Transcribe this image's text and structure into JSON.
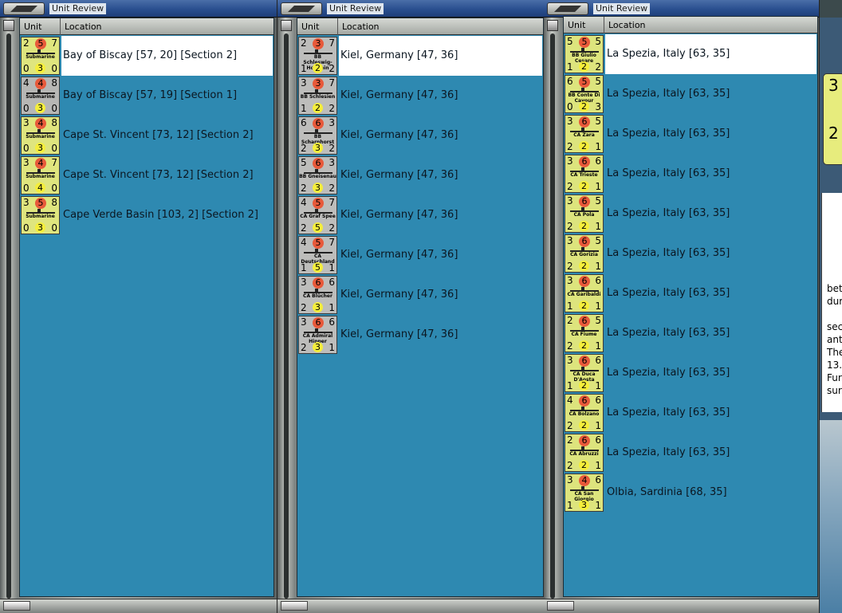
{
  "windows": [
    {
      "title": "Unit Review",
      "columns": {
        "unit": "Unit",
        "location": "Location"
      },
      "rows": [
        {
          "tl": "2",
          "att": "5",
          "tr": "7",
          "name": "Submarine",
          "bl": "0",
          "def": "3",
          "br": "0",
          "style": "sub",
          "location": "Bay of Biscay [57, 20] [Section 2]",
          "selected": true
        },
        {
          "tl": "4",
          "att": "4",
          "tr": "8",
          "name": "Submarine",
          "bl": "0",
          "def": "3",
          "br": "0",
          "style": "subg",
          "location": "Bay of Biscay [57, 19] [Section 1]"
        },
        {
          "tl": "3",
          "att": "4",
          "tr": "8",
          "name": "Submarine",
          "bl": "0",
          "def": "3",
          "br": "0",
          "style": "sub",
          "location": "Cape St. Vincent [73, 12] [Section 2]"
        },
        {
          "tl": "3",
          "att": "4",
          "tr": "7",
          "name": "Submarine",
          "bl": "0",
          "def": "4",
          "br": "0",
          "style": "sub",
          "location": "Cape St. Vincent [73, 12] [Section 2]"
        },
        {
          "tl": "3",
          "att": "5",
          "tr": "8",
          "name": "Submarine",
          "bl": "0",
          "def": "3",
          "br": "0",
          "style": "sub",
          "location": "Cape Verde Basin [103, 2] [Section 2]"
        }
      ]
    },
    {
      "title": "Unit Review",
      "columns": {
        "unit": "Unit",
        "location": "Location"
      },
      "rows": [
        {
          "tl": "2",
          "att": "3",
          "tr": "7",
          "name": "BB Schleswig-Holstein",
          "bl": "1",
          "def": "2",
          "br": "2",
          "style": "ger",
          "location": "Kiel, Germany [47, 36]",
          "selected": true
        },
        {
          "tl": "3",
          "att": "3",
          "tr": "7",
          "name": "BB Schlesien",
          "bl": "1",
          "def": "2",
          "br": "2",
          "style": "ger",
          "location": "Kiel, Germany [47, 36]"
        },
        {
          "tl": "6",
          "att": "6",
          "tr": "3",
          "name": "BB Scharnhorst",
          "bl": "2",
          "def": "3",
          "br": "2",
          "style": "ger",
          "location": "Kiel, Germany [47, 36]"
        },
        {
          "tl": "5",
          "att": "6",
          "tr": "3",
          "name": "BB Gneisenau",
          "bl": "2",
          "def": "3",
          "br": "2",
          "style": "ger",
          "location": "Kiel, Germany [47, 36]"
        },
        {
          "tl": "4",
          "att": "5",
          "tr": "7",
          "name": "CA Graf Spee",
          "bl": "2",
          "def": "5",
          "br": "2",
          "style": "ger",
          "location": "Kiel, Germany [47, 36]"
        },
        {
          "tl": "4",
          "att": "5",
          "tr": "7",
          "name": "CA Deutschland",
          "bl": "1",
          "def": "5",
          "br": "1",
          "style": "ger",
          "location": "Kiel, Germany [47, 36]"
        },
        {
          "tl": "3",
          "att": "6",
          "tr": "6",
          "name": "CA Blücher",
          "bl": "2",
          "def": "3",
          "br": "1",
          "style": "ger",
          "location": "Kiel, Germany [47, 36]"
        },
        {
          "tl": "3",
          "att": "6",
          "tr": "6",
          "name": "CA Admiral Hipper",
          "bl": "2",
          "def": "3",
          "br": "1",
          "style": "ger",
          "location": "Kiel, Germany [47, 36]"
        }
      ]
    },
    {
      "title": "Unit Review",
      "columns": {
        "unit": "Unit",
        "location": "Location"
      },
      "rows": [
        {
          "tl": "5",
          "att": "5",
          "tr": "5",
          "name": "BB Giulio Cesare",
          "bl": "1",
          "def": "2",
          "br": "2",
          "style": "ita",
          "location": "La Spezia, Italy [63, 35]",
          "selected": true
        },
        {
          "tl": "6",
          "att": "5",
          "tr": "5",
          "name": "BB Conte Di Cavour",
          "bl": "0",
          "def": "2",
          "br": "3",
          "style": "ita",
          "location": "La Spezia, Italy [63, 35]"
        },
        {
          "tl": "3",
          "att": "6",
          "tr": "5",
          "name": "CA Zara",
          "bl": "2",
          "def": "2",
          "br": "1",
          "style": "ita",
          "location": "La Spezia, Italy [63, 35]"
        },
        {
          "tl": "3",
          "att": "6",
          "tr": "6",
          "name": "CA Trieste",
          "bl": "2",
          "def": "2",
          "br": "1",
          "style": "ita",
          "location": "La Spezia, Italy [63, 35]"
        },
        {
          "tl": "3",
          "att": "6",
          "tr": "5",
          "name": "CA Pola",
          "bl": "2",
          "def": "2",
          "br": "1",
          "style": "ita",
          "location": "La Spezia, Italy [63, 35]"
        },
        {
          "tl": "3",
          "att": "6",
          "tr": "5",
          "name": "CA Gorizia",
          "bl": "2",
          "def": "2",
          "br": "1",
          "style": "ita",
          "location": "La Spezia, Italy [63, 35]"
        },
        {
          "tl": "3",
          "att": "6",
          "tr": "6",
          "name": "CA Garibaldi",
          "bl": "1",
          "def": "2",
          "br": "1",
          "style": "ita",
          "location": "La Spezia, Italy [63, 35]"
        },
        {
          "tl": "2",
          "att": "6",
          "tr": "5",
          "name": "CA Fiume",
          "bl": "2",
          "def": "2",
          "br": "1",
          "style": "ita",
          "location": "La Spezia, Italy [63, 35]"
        },
        {
          "tl": "3",
          "att": "6",
          "tr": "6",
          "name": "CA Duca D'Aosta",
          "bl": "1",
          "def": "2",
          "br": "1",
          "style": "ita",
          "location": "La Spezia, Italy [63, 35]"
        },
        {
          "tl": "4",
          "att": "6",
          "tr": "6",
          "name": "CA Bolzano",
          "bl": "2",
          "def": "2",
          "br": "1",
          "style": "ita",
          "location": "La Spezia, Italy [63, 35]"
        },
        {
          "tl": "2",
          "att": "6",
          "tr": "6",
          "name": "CA Abruzzi",
          "bl": "2",
          "def": "2",
          "br": "1",
          "style": "ita",
          "location": "La Spezia, Italy [63, 35]"
        },
        {
          "tl": "3",
          "att": "4",
          "tr": "6",
          "name": "CA San Giorgio",
          "bl": "1",
          "def": "3",
          "br": "1",
          "style": "ita",
          "location": "Olbia, Sardinia [68, 35]"
        }
      ]
    }
  ],
  "side_panel": {
    "card_top": "3",
    "card_bottom": "2",
    "text_lines": [
      "bet",
      "dur",
      "",
      "sec",
      "ant",
      "The",
      "13.",
      "Fur",
      "sur"
    ]
  }
}
